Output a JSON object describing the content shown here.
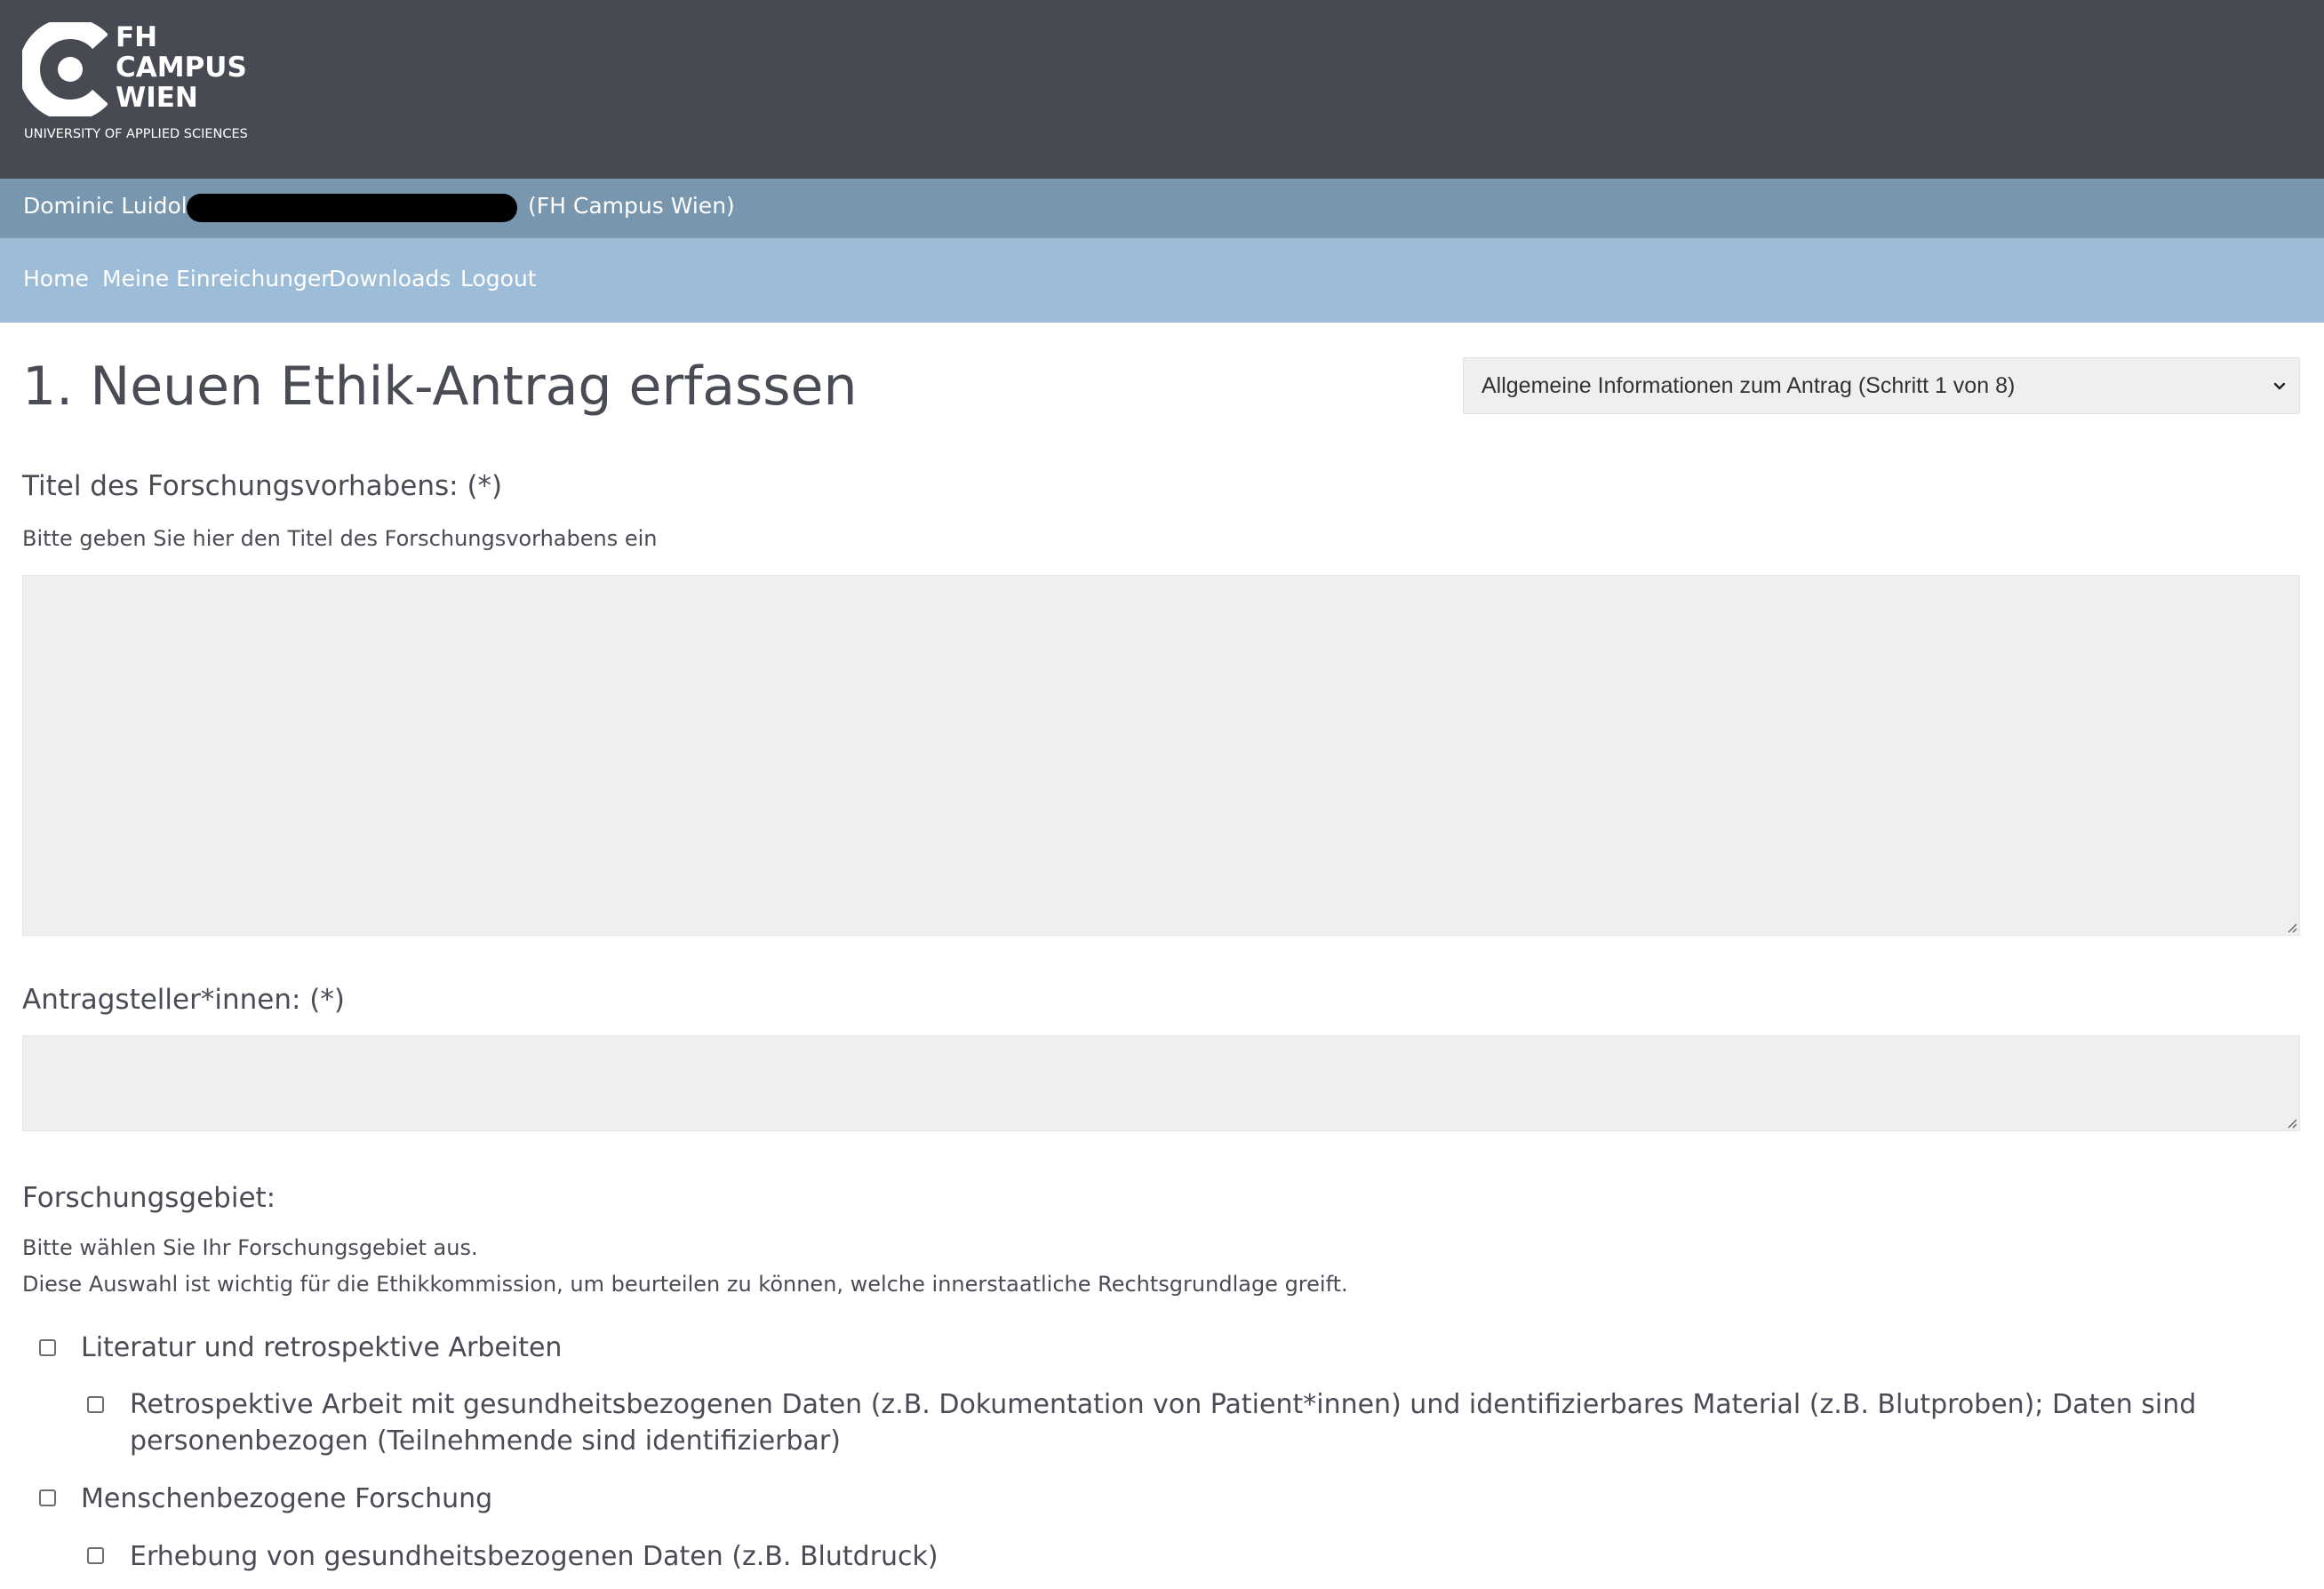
{
  "brand": {
    "logo_line1": "FH",
    "logo_line2": "CAMPUS",
    "logo_line3": "WIEN",
    "logo_subtitle": "UNIVERSITY OF APPLIED SCIENCES"
  },
  "user": {
    "name": "Dominic Luidold",
    "organization": "(FH Campus Wien)"
  },
  "nav": {
    "items": [
      {
        "label": "Home"
      },
      {
        "label": "Meine Einreichungen"
      },
      {
        "label": "Downloads"
      },
      {
        "label": "Logout"
      }
    ]
  },
  "form": {
    "title": "1. Neuen Ethik-Antrag erfassen",
    "step_select": {
      "selected": "Allgemeine Informationen zum Antrag (Schritt 1 von 8)"
    },
    "research_title": {
      "label": "Titel des Forschungsvorhabens: (*)",
      "help": "Bitte geben Sie hier den Titel des Forschungsvorhabens ein",
      "value": ""
    },
    "applicants": {
      "label": "Antragsteller*innen: (*)",
      "value": ""
    },
    "research_field": {
      "label": "Forschungsgebiet:",
      "help_line1": "Bitte wählen Sie Ihr Forschungsgebiet aus.",
      "help_line2": "Diese Auswahl ist wichtig für die Ethikkommission, um beurteilen zu können, welche innerstaatliche Rechtsgrundlage greift.",
      "options": [
        {
          "label": "Literatur und retrospektive Arbeiten",
          "checked": false
        },
        {
          "label": "Retrospektive Arbeit mit gesundheitsbezogenen Daten (z.B. Dokumentation von Patient*innen) und identifizierbares Material (z.B. Blutproben); Daten sind personenbezogen (Teilnehmende sind identifizierbar)",
          "checked": false
        },
        {
          "label": "Menschenbezogene Forschung",
          "checked": false
        },
        {
          "label": "Erhebung von gesundheitsbezogenen Daten (z.B. Blutdruck)",
          "checked": false
        }
      ]
    }
  },
  "colors": {
    "header_bg": "#474a53",
    "userbar_bg": "#7896ad",
    "navbar_bg": "#9dbcd7",
    "text": "#4a4c55",
    "input_bg": "#efefef"
  }
}
